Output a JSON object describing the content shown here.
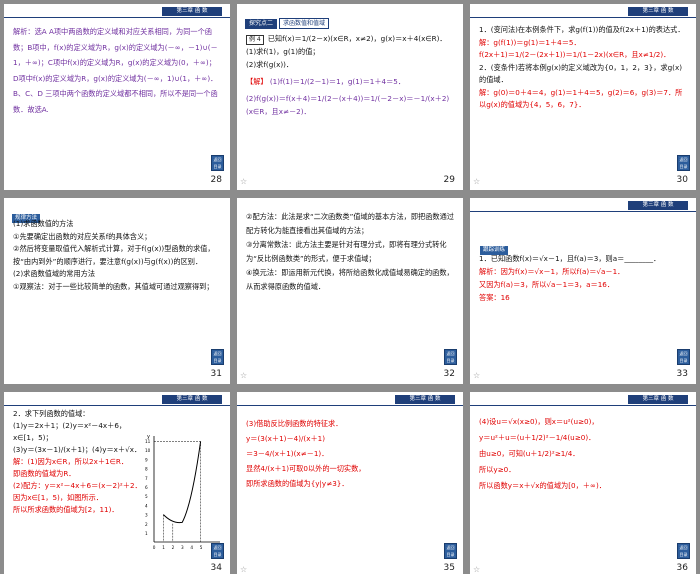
{
  "chapter_label": "第三章  函 数",
  "nav_label": "返回目录",
  "slides": [
    {
      "num": "28",
      "text": "解析：选A  A项中两函数的定义域和对应关系相同，为同一个函数；B项中，f(x)的定义域为R，g(x)的定义域为(－∞，－1)∪(－1，＋∞)；C项中f(x)的定义域为R，g(x)的定义域为(0，＋∞)；D项中f(x)的定义域为R，g(x)的定义域为(－∞，1)∪(1，＋∞)．B、C、D 三项中两个函数的定义域都不相同，所以不是同一个函数．故选A."
    },
    {
      "num": "29",
      "tag": "探究点二",
      "tag_title": "求函数值和值域",
      "ex": "例 4",
      "q1": "已知f(x)＝1/(2－x)(x∈R，x≠2)，g(x)＝x＋4(x∈R)．",
      "q2": "(1)求f(1)，g(1)的值；",
      "q3": "(2)求f(g(x))．",
      "a_label": "【解】",
      "a1": "(1)f(1)＝1/(2－1)＝1，g(1)＝1＋4＝5．",
      "a2": "(2)f(g(x))＝f(x＋4)＝1/(2－(x＋4))＝1/(－2－x)＝－1/(x＋2)(x∈R，且x≠－2)．"
    },
    {
      "num": "30",
      "q1": "1．(变问法)在本例条件下，求g(f(1))的值及f(2x＋1)的表达式．",
      "a1": "解：g(f(1))＝g(1)＝1＋4＝5．",
      "a2": "f(2x＋1)＝1/(2－(2x＋1))＝1/(1－2x)(x∈R，且x≠1/2)．",
      "q2": "2．(变条件)若将本例g(x)的定义域改为{0，1，2，3}，求g(x)的值域．",
      "a3": "解：g(0)＝0＋4＝4，g(1)＝1＋4＝5，g(2)＝6，g(3)＝7．所以g(x)的值域为{4，5，6，7}．"
    },
    {
      "num": "31",
      "tag": "规律方法",
      "l1": "(1)求函数值的方法",
      "l2": "①先要确定出函数的对应关系f的具体含义；",
      "l3": "②然后将变量取值代入解析式计算，对于f(g(x))型函数的求值，按“由内到外”的顺序进行，要注意f(g(x))与g(f(x))的区别．",
      "l4": "(2)求函数值域的常用方法",
      "l5": "①观察法：对于一些比较简单的函数，其值域可通过观察得到；"
    },
    {
      "num": "32",
      "l1": "②配方法：此法是求“二次函数类”值域的基本方法，即把函数通过配方转化为能直接看出其值域的方法；",
      "l2": "③分离常数法：此方法主要是针对有理分式，即将有理分式转化为“反比例函数类”的形式，便于求值域；",
      "l3": "④换元法：即运用新元代换，将所给函数化成值域易确定的函数，从而求得原函数的值域．"
    },
    {
      "num": "33",
      "tag": "跟踪训练",
      "q1": "1．已知函数f(x)＝√x－1，且f(a)＝3，则a＝________．",
      "a1": "解析：因为f(x)＝√x－1，所以f(a)＝√a－1．",
      "a2": "又因为f(a)＝3，所以√a－1＝3，a＝16．",
      "a3": "答案：16"
    },
    {
      "num": "34",
      "q": "2．求下列函数的值域：",
      "p1": "(1)y＝2x＋1；(2)y＝x²－4x＋6，x∈[1，5)；",
      "p2": "(3)y＝(3x－1)/(x＋1)；(4)y＝x＋√x．",
      "s1": "解：(1)因为x∈R，所以2x＋1∈R．",
      "s2": "即函数的值域为R．",
      "s3": "(2)配方：y＝x²－4x＋6＝(x－2)²＋2．",
      "s4": "因为x∈[1，5)，如图所示．",
      "s5": "所以所求函数的值域为[2，11)．",
      "graph_ticks_y": [
        "11",
        "10",
        "9",
        "8",
        "7",
        "6",
        "5",
        "4",
        "3",
        "2",
        "1"
      ],
      "graph_ticks_x": [
        "0",
        "1",
        "2",
        "3",
        "4",
        "5"
      ],
      "graph_x": "x",
      "graph_y": "y"
    },
    {
      "num": "35",
      "l1": "(3)借助反比例函数的特征求．",
      "l2": "y＝(3(x＋1)－4)/(x＋1)",
      "l3": "＝3－4/(x＋1)(x≠－1)．",
      "l4": "显然4/(x＋1)可取0以外的一切实数，",
      "l5": "即所求函数的值域为{y|y≠3}．"
    },
    {
      "num": "36",
      "l1": "(4)设u＝√x(x≥0)，则x＝u²(u≥0)，",
      "l2": "y＝u²＋u＝(u＋1/2)²－1/4(u≥0)．",
      "l3": "由u≥0，可知(u＋1/2)²≥1/4．",
      "l4": "所以y≥0．",
      "l5": "所以函数y＝x＋√x的值域为[0，＋∞)．"
    }
  ]
}
